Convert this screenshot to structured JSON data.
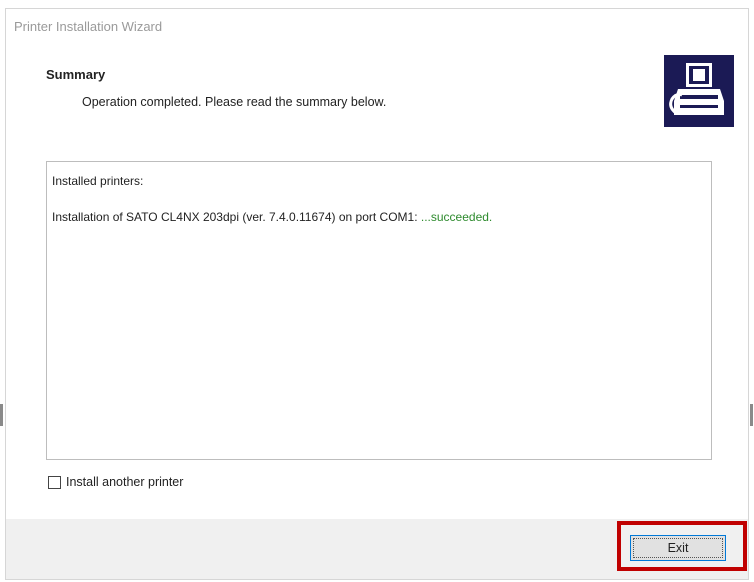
{
  "window": {
    "title": "Printer Installation Wizard"
  },
  "header": {
    "title": "Summary",
    "subtitle": "Operation completed. Please read the summary below.",
    "logo_icon": "printer-wizard-icon"
  },
  "summary": {
    "heading": "Installed printers:",
    "install_text": "Installation of SATO CL4NX 203dpi (ver. 7.4.0.11674) on port COM1: ",
    "install_status": "...succeeded."
  },
  "options": {
    "install_another_label": "Install another printer",
    "install_another_checked": false
  },
  "footer": {
    "exit_label": "Exit"
  },
  "colors": {
    "success": "#2e8b2e",
    "highlight": "#c00000",
    "logo_bg": "#1b1a55"
  }
}
